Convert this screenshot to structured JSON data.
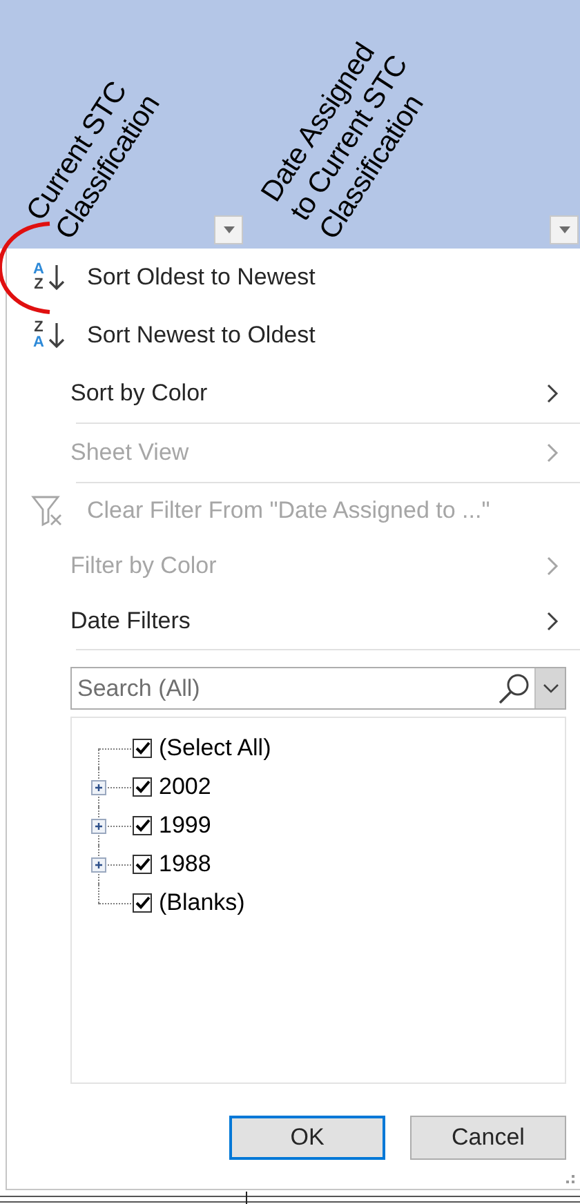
{
  "headers": [
    {
      "lines": [
        "Current STC",
        "Classification"
      ]
    },
    {
      "lines": [
        "Date Assigned",
        "to Current STC",
        "Classification"
      ]
    }
  ],
  "menu_items": [
    {
      "kind": "sort_ascending",
      "icon_text": [
        "A",
        "Z"
      ],
      "label": "Sort Oldest to Newest",
      "disabled": false,
      "submenu": false,
      "separator_after": false
    },
    {
      "kind": "sort_descending",
      "icon_text": [
        "Z",
        "A"
      ],
      "label": "Sort Newest to Oldest",
      "disabled": false,
      "submenu": false,
      "separator_after": false
    },
    {
      "kind": "plain",
      "label": "Sort by Color",
      "disabled": false,
      "submenu": true,
      "separator_after": true
    },
    {
      "kind": "plain",
      "label": "Sheet View",
      "disabled": true,
      "submenu": true,
      "separator_after": true
    },
    {
      "kind": "clear_filter",
      "label": "Clear Filter From \"Date Assigned to ...\"",
      "disabled": true,
      "submenu": false,
      "separator_after": false
    },
    {
      "kind": "plain",
      "label": "Filter by Color",
      "disabled": true,
      "submenu": true,
      "separator_after": false
    },
    {
      "kind": "plain",
      "label": "Date Filters",
      "disabled": false,
      "submenu": true,
      "separator_after": true
    }
  ],
  "search": {
    "placeholder": "Search (All)"
  },
  "filter_values": [
    {
      "kind": "leaf",
      "label": "(Select All)",
      "checked": true
    },
    {
      "kind": "group",
      "label": "2002",
      "checked": true,
      "expanded": false
    },
    {
      "kind": "group",
      "label": "1999",
      "checked": true,
      "expanded": false
    },
    {
      "kind": "group",
      "label": "1988",
      "checked": true,
      "expanded": false
    },
    {
      "kind": "leaf",
      "label": "(Blanks)",
      "checked": true
    }
  ],
  "buttons": [
    {
      "label": "OK",
      "default": true
    },
    {
      "label": "Cancel",
      "default": false
    }
  ]
}
